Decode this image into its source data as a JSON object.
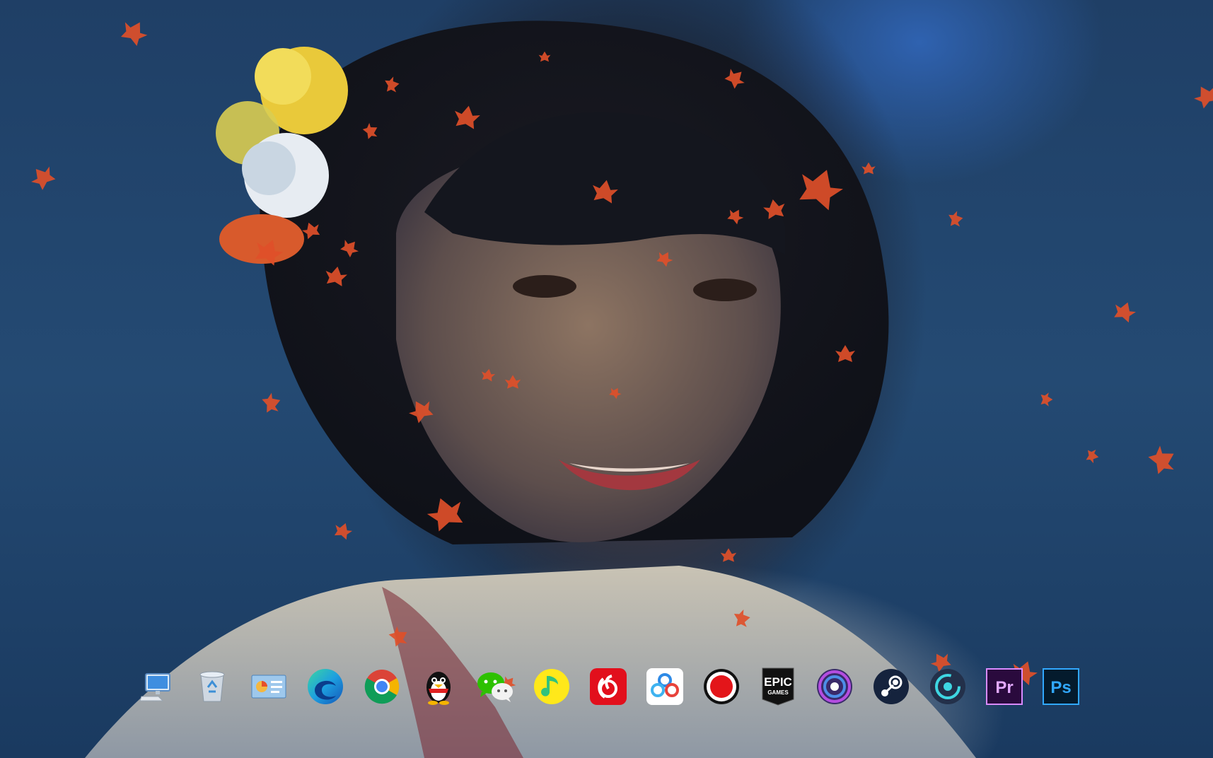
{
  "desktop": {
    "wallpaper": "portrait-photo-with-falling-maple-leaves",
    "accent_colors": {
      "background": "#1d3f63",
      "leaf": "#e0502a"
    }
  },
  "dock": {
    "items": [
      {
        "name": "this-pc",
        "icon": "computer-icon"
      },
      {
        "name": "recycle-bin",
        "icon": "recycle-bin-icon"
      },
      {
        "name": "control-panel",
        "icon": "control-panel-icon"
      },
      {
        "name": "microsoft-edge",
        "icon": "edge-icon"
      },
      {
        "name": "google-chrome",
        "icon": "chrome-icon"
      },
      {
        "name": "qq",
        "icon": "penguin-icon"
      },
      {
        "name": "wechat",
        "icon": "wechat-icon"
      },
      {
        "name": "qq-music",
        "icon": "music-note-icon"
      },
      {
        "name": "netease-cloud-music",
        "icon": "netease-music-icon"
      },
      {
        "name": "baidu-netdisk",
        "icon": "cloud-disk-icon"
      },
      {
        "name": "screen-recorder",
        "icon": "record-icon"
      },
      {
        "name": "epic-games-launcher",
        "icon": "epic-games-icon",
        "label_top": "EPIC",
        "label_bottom": "GAMES"
      },
      {
        "name": "ubisoft-connect",
        "icon": "ubisoft-icon"
      },
      {
        "name": "steam",
        "icon": "steam-icon"
      },
      {
        "name": "timer-app",
        "icon": "circular-timer-icon"
      },
      {
        "name": "adobe-premiere-pro",
        "icon": "premiere-icon",
        "label": "Pr"
      },
      {
        "name": "adobe-photoshop",
        "icon": "photoshop-icon",
        "label": "Ps"
      }
    ]
  }
}
